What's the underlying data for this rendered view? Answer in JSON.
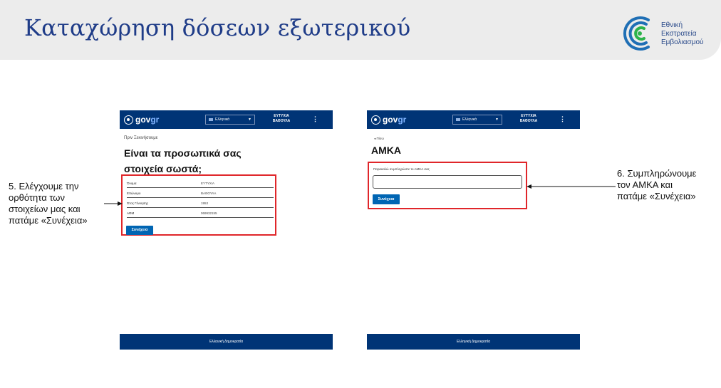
{
  "slide": {
    "title": "Καταχώρηση δόσεων εξωτερικού",
    "logo_lines": [
      "Εθνική",
      "Εκστρατεία",
      "Εμβολιασμού"
    ]
  },
  "gov": {
    "logo_text": "gov",
    "logo_suffix": "gr",
    "language": "Ελληνικά",
    "user_name_line1": "ΕΥΤΥΧΙΑ",
    "user_name_line2": "ΒΑΘΟΥΛΑ",
    "menu_glyph": "⋮",
    "footer": "Ελληνική Δημοκρατία"
  },
  "screen1": {
    "pretitle": "Πριν Ξεκινήσουμε",
    "heading_line1": "Είναι τα προσωπικά σας",
    "heading_line2": "στοιχεία σωστά;",
    "rows": [
      {
        "label": "Όνομα",
        "value": "ΕΥΤΥΧΙΑ"
      },
      {
        "label": "Επώνυμο",
        "value": "ΒΑΘΟΥΛΑ"
      },
      {
        "label": "Έτος Γέννησης",
        "value": "1953"
      },
      {
        "label": "ΑΦΜ",
        "value": "069932155"
      }
    ],
    "continue_label": "Συνέχεια"
  },
  "screen2": {
    "back_label": "Πίσω",
    "title": "ΑΜΚΑ",
    "field_label": "Παρακαλώ συμπληρώστε το ΑΜΚΑ σας",
    "amka_value": "",
    "continue_label": "Συνέχεια"
  },
  "callouts": {
    "step5": [
      "5. Ελέγχουμε την",
      "ορθότητα των",
      "στοιχείων μας και",
      "πατάμε «Συνέχεια»"
    ],
    "step6": [
      "6. Συμπληρώνουμε",
      "τον ΑΜΚΑ και",
      "πατάμε «Συνέχεια»"
    ]
  },
  "colors": {
    "title_blue": "#1f3c88",
    "gov_blue": "#003476",
    "button_blue": "#0065b3",
    "highlight_red": "#e0262a",
    "logo_green": "#2db34a"
  }
}
